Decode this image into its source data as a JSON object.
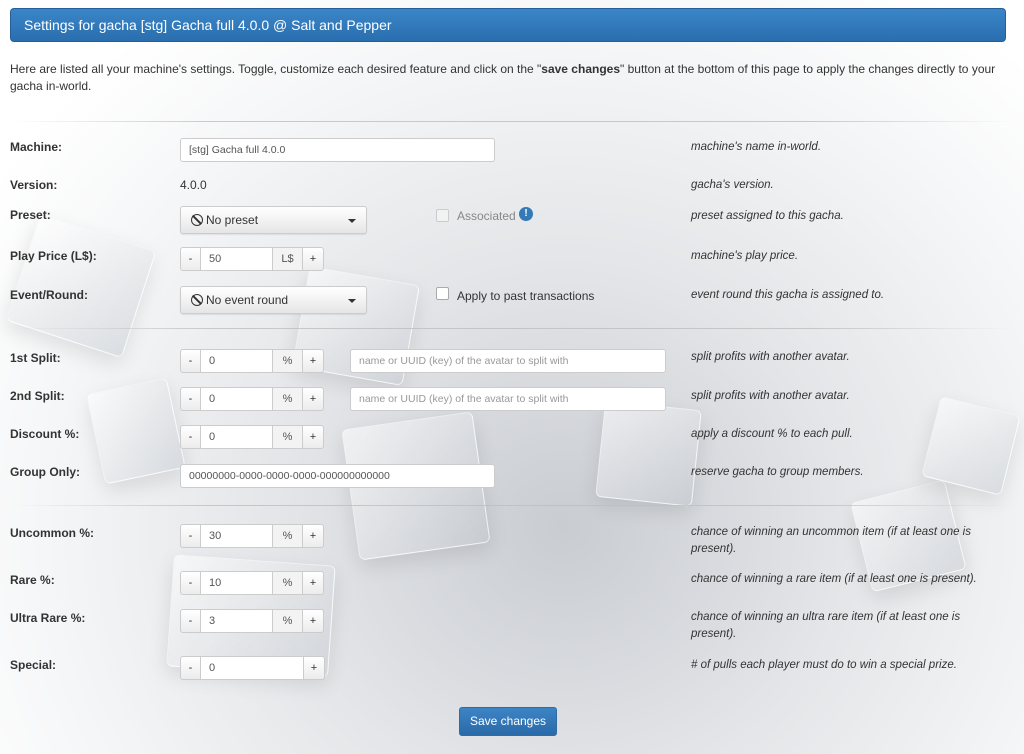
{
  "header": {
    "title": "Settings for gacha [stg] Gacha full 4.0.0 @ Salt and Pepper"
  },
  "intro": {
    "before": "Here are listed all your machine's settings. Toggle, customize each desired feature and click on the \"",
    "bold": "save changes",
    "after": "\" button at the bottom of this page to apply the changes directly to your gacha in-world."
  },
  "machine": {
    "label": "Machine:",
    "value": "[stg] Gacha full 4.0.0",
    "help": "machine's name in-world."
  },
  "version": {
    "label": "Version:",
    "value": "4.0.0",
    "help": "gacha's version."
  },
  "preset": {
    "label": "Preset:",
    "value": "No preset",
    "associated_label": "Associated",
    "info_icon": "info-icon",
    "help": "preset assigned to this gacha."
  },
  "play_price": {
    "label": "Play Price (L$):",
    "value": "50",
    "unit": "L$",
    "minus": "-",
    "plus": "+",
    "help": "machine's play price."
  },
  "event_round": {
    "label": "Event/Round:",
    "value": "No event round",
    "apply_label": "Apply to past transactions",
    "help": "event round this gacha is assigned to."
  },
  "split1": {
    "label": "1st Split:",
    "value": "0",
    "unit": "%",
    "minus": "-",
    "plus": "+",
    "placeholder": "name or UUID (key) of the avatar to split with",
    "help": "split profits with another avatar."
  },
  "split2": {
    "label": "2nd Split:",
    "value": "0",
    "unit": "%",
    "minus": "-",
    "plus": "+",
    "placeholder": "name or UUID (key) of the avatar to split with",
    "help": "split profits with another avatar."
  },
  "discount": {
    "label": "Discount %:",
    "value": "0",
    "unit": "%",
    "minus": "-",
    "plus": "+",
    "help": "apply a discount % to each pull."
  },
  "group_only": {
    "label": "Group Only:",
    "value": "00000000-0000-0000-0000-000000000000",
    "help": "reserve gacha to group members."
  },
  "uncommon": {
    "label": "Uncommon %:",
    "value": "30",
    "unit": "%",
    "minus": "-",
    "plus": "+",
    "help": "chance of winning an uncommon item (if at least one is present)."
  },
  "rare": {
    "label": "Rare %:",
    "value": "10",
    "unit": "%",
    "minus": "-",
    "plus": "+",
    "help": "chance of winning a rare item (if at least one is present)."
  },
  "ultra_rare": {
    "label": "Ultra Rare %:",
    "value": "3",
    "unit": "%",
    "minus": "-",
    "plus": "+",
    "help": "chance of winning an ultra rare item (if at least one is present)."
  },
  "special": {
    "label": "Special:",
    "value": "0",
    "minus": "-",
    "plus": "+",
    "help": "# of pulls each player must do to win a special prize."
  },
  "save_button": "Save changes",
  "colors": {
    "header": "#2f77b9",
    "save": "#3277b3",
    "info": "#337ab7"
  }
}
